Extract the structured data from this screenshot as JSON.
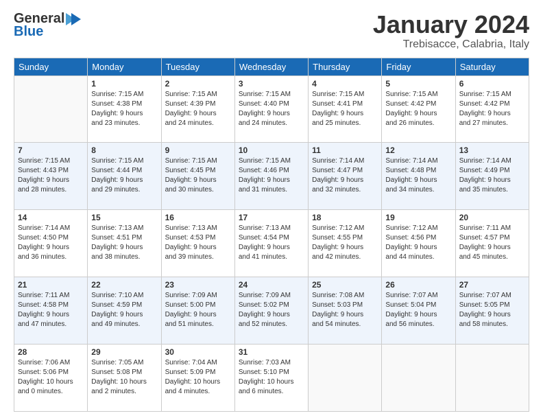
{
  "header": {
    "logo_line1": "General",
    "logo_line2": "Blue",
    "month_title": "January 2024",
    "location": "Trebisacce, Calabria, Italy"
  },
  "days_of_week": [
    "Sunday",
    "Monday",
    "Tuesday",
    "Wednesday",
    "Thursday",
    "Friday",
    "Saturday"
  ],
  "weeks": [
    [
      {
        "day": "",
        "content": ""
      },
      {
        "day": "1",
        "content": "Sunrise: 7:15 AM\nSunset: 4:38 PM\nDaylight: 9 hours\nand 23 minutes."
      },
      {
        "day": "2",
        "content": "Sunrise: 7:15 AM\nSunset: 4:39 PM\nDaylight: 9 hours\nand 24 minutes."
      },
      {
        "day": "3",
        "content": "Sunrise: 7:15 AM\nSunset: 4:40 PM\nDaylight: 9 hours\nand 24 minutes."
      },
      {
        "day": "4",
        "content": "Sunrise: 7:15 AM\nSunset: 4:41 PM\nDaylight: 9 hours\nand 25 minutes."
      },
      {
        "day": "5",
        "content": "Sunrise: 7:15 AM\nSunset: 4:42 PM\nDaylight: 9 hours\nand 26 minutes."
      },
      {
        "day": "6",
        "content": "Sunrise: 7:15 AM\nSunset: 4:42 PM\nDaylight: 9 hours\nand 27 minutes."
      }
    ],
    [
      {
        "day": "7",
        "content": "Sunrise: 7:15 AM\nSunset: 4:43 PM\nDaylight: 9 hours\nand 28 minutes."
      },
      {
        "day": "8",
        "content": "Sunrise: 7:15 AM\nSunset: 4:44 PM\nDaylight: 9 hours\nand 29 minutes."
      },
      {
        "day": "9",
        "content": "Sunrise: 7:15 AM\nSunset: 4:45 PM\nDaylight: 9 hours\nand 30 minutes."
      },
      {
        "day": "10",
        "content": "Sunrise: 7:15 AM\nSunset: 4:46 PM\nDaylight: 9 hours\nand 31 minutes."
      },
      {
        "day": "11",
        "content": "Sunrise: 7:14 AM\nSunset: 4:47 PM\nDaylight: 9 hours\nand 32 minutes."
      },
      {
        "day": "12",
        "content": "Sunrise: 7:14 AM\nSunset: 4:48 PM\nDaylight: 9 hours\nand 34 minutes."
      },
      {
        "day": "13",
        "content": "Sunrise: 7:14 AM\nSunset: 4:49 PM\nDaylight: 9 hours\nand 35 minutes."
      }
    ],
    [
      {
        "day": "14",
        "content": "Sunrise: 7:14 AM\nSunset: 4:50 PM\nDaylight: 9 hours\nand 36 minutes."
      },
      {
        "day": "15",
        "content": "Sunrise: 7:13 AM\nSunset: 4:51 PM\nDaylight: 9 hours\nand 38 minutes."
      },
      {
        "day": "16",
        "content": "Sunrise: 7:13 AM\nSunset: 4:53 PM\nDaylight: 9 hours\nand 39 minutes."
      },
      {
        "day": "17",
        "content": "Sunrise: 7:13 AM\nSunset: 4:54 PM\nDaylight: 9 hours\nand 41 minutes."
      },
      {
        "day": "18",
        "content": "Sunrise: 7:12 AM\nSunset: 4:55 PM\nDaylight: 9 hours\nand 42 minutes."
      },
      {
        "day": "19",
        "content": "Sunrise: 7:12 AM\nSunset: 4:56 PM\nDaylight: 9 hours\nand 44 minutes."
      },
      {
        "day": "20",
        "content": "Sunrise: 7:11 AM\nSunset: 4:57 PM\nDaylight: 9 hours\nand 45 minutes."
      }
    ],
    [
      {
        "day": "21",
        "content": "Sunrise: 7:11 AM\nSunset: 4:58 PM\nDaylight: 9 hours\nand 47 minutes."
      },
      {
        "day": "22",
        "content": "Sunrise: 7:10 AM\nSunset: 4:59 PM\nDaylight: 9 hours\nand 49 minutes."
      },
      {
        "day": "23",
        "content": "Sunrise: 7:09 AM\nSunset: 5:00 PM\nDaylight: 9 hours\nand 51 minutes."
      },
      {
        "day": "24",
        "content": "Sunrise: 7:09 AM\nSunset: 5:02 PM\nDaylight: 9 hours\nand 52 minutes."
      },
      {
        "day": "25",
        "content": "Sunrise: 7:08 AM\nSunset: 5:03 PM\nDaylight: 9 hours\nand 54 minutes."
      },
      {
        "day": "26",
        "content": "Sunrise: 7:07 AM\nSunset: 5:04 PM\nDaylight: 9 hours\nand 56 minutes."
      },
      {
        "day": "27",
        "content": "Sunrise: 7:07 AM\nSunset: 5:05 PM\nDaylight: 9 hours\nand 58 minutes."
      }
    ],
    [
      {
        "day": "28",
        "content": "Sunrise: 7:06 AM\nSunset: 5:06 PM\nDaylight: 10 hours\nand 0 minutes."
      },
      {
        "day": "29",
        "content": "Sunrise: 7:05 AM\nSunset: 5:08 PM\nDaylight: 10 hours\nand 2 minutes."
      },
      {
        "day": "30",
        "content": "Sunrise: 7:04 AM\nSunset: 5:09 PM\nDaylight: 10 hours\nand 4 minutes."
      },
      {
        "day": "31",
        "content": "Sunrise: 7:03 AM\nSunset: 5:10 PM\nDaylight: 10 hours\nand 6 minutes."
      },
      {
        "day": "",
        "content": ""
      },
      {
        "day": "",
        "content": ""
      },
      {
        "day": "",
        "content": ""
      }
    ]
  ]
}
